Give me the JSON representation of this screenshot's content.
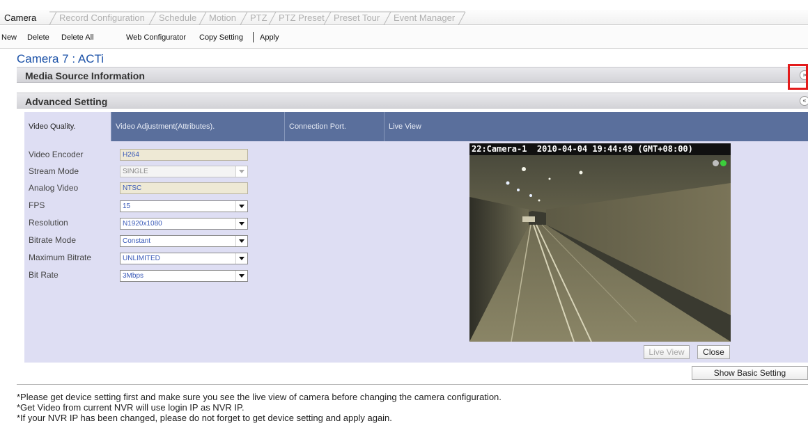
{
  "tabs": [
    {
      "label": "Camera",
      "active": true
    },
    {
      "label": "Record Configuration",
      "active": false
    },
    {
      "label": "Schedule",
      "active": false
    },
    {
      "label": "Motion",
      "active": false
    },
    {
      "label": "PTZ",
      "active": false
    },
    {
      "label": "PTZ Preset",
      "active": false
    },
    {
      "label": "Preset Tour",
      "active": false
    },
    {
      "label": "Event Manager",
      "active": false
    }
  ],
  "toolbar": {
    "new": "New",
    "delete": "Delete",
    "delete_all": "Delete All",
    "web_configurator": "Web Configurator",
    "copy_setting": "Copy Setting",
    "apply": "Apply"
  },
  "camera_title": "Camera 7 : ACTi",
  "sections": {
    "media_source": "Media Source Information",
    "advanced": "Advanced Setting"
  },
  "subtabs": [
    {
      "label": "Video Quality.",
      "active": true
    },
    {
      "label": "Video Adjustment(Attributes).",
      "active": false
    },
    {
      "label": "Connection Port.",
      "active": false
    },
    {
      "label": "Live View",
      "active": false
    }
  ],
  "form": {
    "video_encoder": {
      "label": "Video Encoder",
      "value": "H264"
    },
    "stream_mode": {
      "label": "Stream Mode",
      "value": "SINGLE"
    },
    "analog_video": {
      "label": "Analog Video",
      "value": "NTSC"
    },
    "fps": {
      "label": "FPS",
      "value": "15"
    },
    "resolution": {
      "label": "Resolution",
      "value": "N1920x1080"
    },
    "bitrate_mode": {
      "label": "Bitrate Mode",
      "value": "Constant"
    },
    "maximum_bitrate": {
      "label": "Maximum Bitrate",
      "value": "UNLIMITED"
    },
    "bit_rate": {
      "label": "Bit Rate",
      "value": "3Mbps"
    }
  },
  "live_view": {
    "overlay": "22:Camera-1  2010-04-04 19:44:49 (GMT+08:00)",
    "live_view_button": "Live View",
    "close_button": "Close"
  },
  "show_basic_button": "Show Basic Setting",
  "notes": [
    "*Please get device setting first and make sure you see the live view of camera before changing the camera configuration.",
    "*Get Video from current NVR will use login IP as NVR IP.",
    "*If your NVR IP has been changed, please do not forget to get device setting and apply again."
  ],
  "colors": {
    "title_blue": "#1c52a8",
    "subtab_bar": "#5a6f9c",
    "panel_bg": "#dedef3",
    "highlight_red": "#e31b1b"
  }
}
